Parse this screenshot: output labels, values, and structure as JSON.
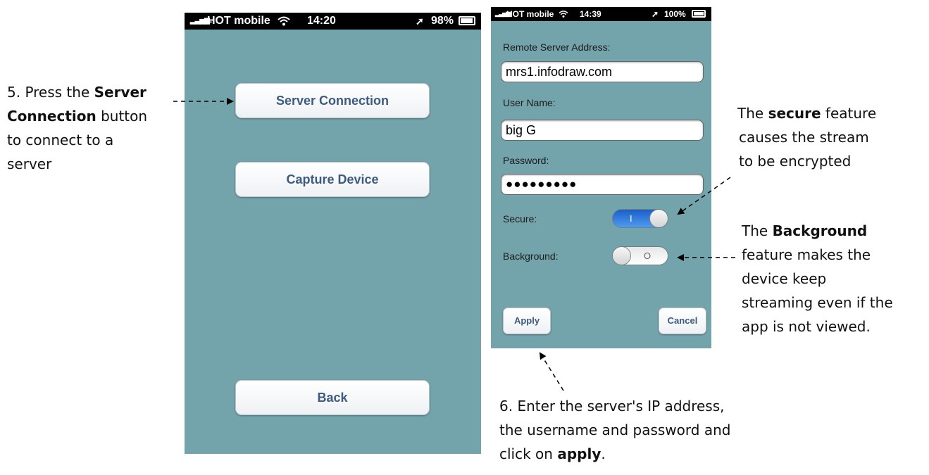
{
  "step5": {
    "l1_pre": "5. Press the ",
    "l1_bold": "Server",
    "l2_bold": "Connection",
    "l2_post": " button",
    "l3": "to connect to a",
    "l4": "server"
  },
  "phone1": {
    "status": {
      "carrier": "HOT mobile",
      "time": "14:20",
      "battery": "98%"
    },
    "buttons": {
      "server_connection": "Server Connection",
      "capture_device": "Capture Device",
      "back": "Back"
    }
  },
  "phone2": {
    "status": {
      "carrier": "HOT mobile",
      "time": "14:39",
      "battery": "100%"
    },
    "labels": {
      "remote_server": "Remote Server Address:",
      "user_name": "User Name:",
      "password": "Password:",
      "secure": "Secure:",
      "background": "Background:"
    },
    "values": {
      "remote_server": "mrs1.infodraw.com",
      "user_name": "big G",
      "password": "●●●●●●●●●"
    },
    "toggles": {
      "secure_on": true,
      "background_on": false,
      "on_mark": "I",
      "off_mark": "O"
    },
    "buttons": {
      "apply": "Apply",
      "cancel": "Cancel"
    }
  },
  "secure_note": {
    "l1_pre": "The ",
    "l1_bold": "secure",
    "l1_post": " feature",
    "l2": "causes the stream",
    "l3": "to be encrypted"
  },
  "background_note": {
    "l1_pre": "The ",
    "l1_bold": "Background",
    "l2": "feature makes the",
    "l3": "device keep",
    "l4": "streaming even if the",
    "l5": "app is not viewed."
  },
  "step6": {
    "l1": "6. Enter the server's IP address,",
    "l2": "the username and password and",
    "l3_pre": "click on ",
    "l3_bold": "apply",
    "l3_post": "."
  },
  "colors": {
    "screen_bg": "#74a4ab",
    "button_text": "#3d5a80",
    "toggle_on": "#2f7be0"
  }
}
